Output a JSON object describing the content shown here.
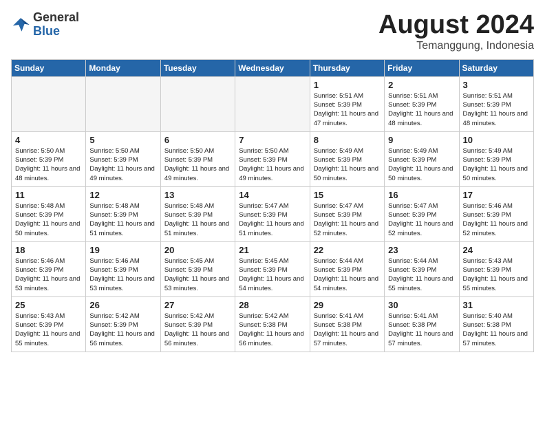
{
  "header": {
    "logo": {
      "general": "General",
      "blue": "Blue"
    },
    "month_year": "August 2024",
    "location": "Temanggung, Indonesia"
  },
  "weekdays": [
    "Sunday",
    "Monday",
    "Tuesday",
    "Wednesday",
    "Thursday",
    "Friday",
    "Saturday"
  ],
  "weeks": [
    [
      {
        "day": "",
        "empty": true
      },
      {
        "day": "",
        "empty": true
      },
      {
        "day": "",
        "empty": true
      },
      {
        "day": "",
        "empty": true
      },
      {
        "day": "1",
        "sunrise": "5:51 AM",
        "sunset": "5:39 PM",
        "daylight": "11 hours and 47 minutes."
      },
      {
        "day": "2",
        "sunrise": "5:51 AM",
        "sunset": "5:39 PM",
        "daylight": "11 hours and 48 minutes."
      },
      {
        "day": "3",
        "sunrise": "5:51 AM",
        "sunset": "5:39 PM",
        "daylight": "11 hours and 48 minutes."
      }
    ],
    [
      {
        "day": "4",
        "sunrise": "5:50 AM",
        "sunset": "5:39 PM",
        "daylight": "11 hours and 48 minutes."
      },
      {
        "day": "5",
        "sunrise": "5:50 AM",
        "sunset": "5:39 PM",
        "daylight": "11 hours and 49 minutes."
      },
      {
        "day": "6",
        "sunrise": "5:50 AM",
        "sunset": "5:39 PM",
        "daylight": "11 hours and 49 minutes."
      },
      {
        "day": "7",
        "sunrise": "5:50 AM",
        "sunset": "5:39 PM",
        "daylight": "11 hours and 49 minutes."
      },
      {
        "day": "8",
        "sunrise": "5:49 AM",
        "sunset": "5:39 PM",
        "daylight": "11 hours and 50 minutes."
      },
      {
        "day": "9",
        "sunrise": "5:49 AM",
        "sunset": "5:39 PM",
        "daylight": "11 hours and 50 minutes."
      },
      {
        "day": "10",
        "sunrise": "5:49 AM",
        "sunset": "5:39 PM",
        "daylight": "11 hours and 50 minutes."
      }
    ],
    [
      {
        "day": "11",
        "sunrise": "5:48 AM",
        "sunset": "5:39 PM",
        "daylight": "11 hours and 50 minutes."
      },
      {
        "day": "12",
        "sunrise": "5:48 AM",
        "sunset": "5:39 PM",
        "daylight": "11 hours and 51 minutes."
      },
      {
        "day": "13",
        "sunrise": "5:48 AM",
        "sunset": "5:39 PM",
        "daylight": "11 hours and 51 minutes."
      },
      {
        "day": "14",
        "sunrise": "5:47 AM",
        "sunset": "5:39 PM",
        "daylight": "11 hours and 51 minutes."
      },
      {
        "day": "15",
        "sunrise": "5:47 AM",
        "sunset": "5:39 PM",
        "daylight": "11 hours and 52 minutes."
      },
      {
        "day": "16",
        "sunrise": "5:47 AM",
        "sunset": "5:39 PM",
        "daylight": "11 hours and 52 minutes."
      },
      {
        "day": "17",
        "sunrise": "5:46 AM",
        "sunset": "5:39 PM",
        "daylight": "11 hours and 52 minutes."
      }
    ],
    [
      {
        "day": "18",
        "sunrise": "5:46 AM",
        "sunset": "5:39 PM",
        "daylight": "11 hours and 53 minutes."
      },
      {
        "day": "19",
        "sunrise": "5:46 AM",
        "sunset": "5:39 PM",
        "daylight": "11 hours and 53 minutes."
      },
      {
        "day": "20",
        "sunrise": "5:45 AM",
        "sunset": "5:39 PM",
        "daylight": "11 hours and 53 minutes."
      },
      {
        "day": "21",
        "sunrise": "5:45 AM",
        "sunset": "5:39 PM",
        "daylight": "11 hours and 54 minutes."
      },
      {
        "day": "22",
        "sunrise": "5:44 AM",
        "sunset": "5:39 PM",
        "daylight": "11 hours and 54 minutes."
      },
      {
        "day": "23",
        "sunrise": "5:44 AM",
        "sunset": "5:39 PM",
        "daylight": "11 hours and 55 minutes."
      },
      {
        "day": "24",
        "sunrise": "5:43 AM",
        "sunset": "5:39 PM",
        "daylight": "11 hours and 55 minutes."
      }
    ],
    [
      {
        "day": "25",
        "sunrise": "5:43 AM",
        "sunset": "5:39 PM",
        "daylight": "11 hours and 55 minutes."
      },
      {
        "day": "26",
        "sunrise": "5:42 AM",
        "sunset": "5:39 PM",
        "daylight": "11 hours and 56 minutes."
      },
      {
        "day": "27",
        "sunrise": "5:42 AM",
        "sunset": "5:39 PM",
        "daylight": "11 hours and 56 minutes."
      },
      {
        "day": "28",
        "sunrise": "5:42 AM",
        "sunset": "5:38 PM",
        "daylight": "11 hours and 56 minutes."
      },
      {
        "day": "29",
        "sunrise": "5:41 AM",
        "sunset": "5:38 PM",
        "daylight": "11 hours and 57 minutes."
      },
      {
        "day": "30",
        "sunrise": "5:41 AM",
        "sunset": "5:38 PM",
        "daylight": "11 hours and 57 minutes."
      },
      {
        "day": "31",
        "sunrise": "5:40 AM",
        "sunset": "5:38 PM",
        "daylight": "11 hours and 57 minutes."
      }
    ]
  ],
  "labels": {
    "sunrise": "Sunrise:",
    "sunset": "Sunset:",
    "daylight": "Daylight:"
  }
}
